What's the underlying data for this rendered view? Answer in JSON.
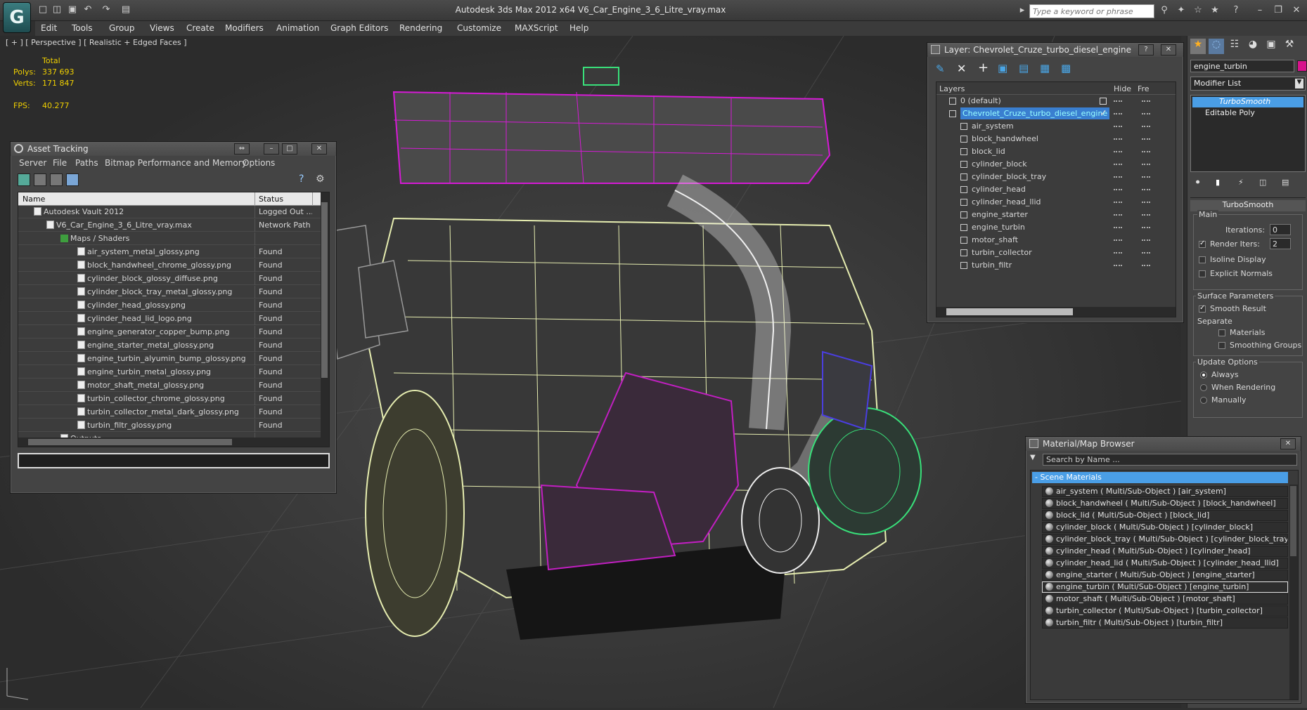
{
  "app": {
    "logo": "G",
    "title": "Autodesk 3ds Max  2012 x64     V6_Car_Engine_3_6_Litre_vray.max",
    "search_placeholder": "Type a keyword or phrase"
  },
  "menu": [
    "Edit",
    "Tools",
    "Group",
    "Views",
    "Create",
    "Modifiers",
    "Animation",
    "Graph Editors",
    "Rendering",
    "Customize",
    "MAXScript",
    "Help"
  ],
  "viewport": {
    "label": "[ + ] [ Perspective ] [ Realistic + Edged Faces ]",
    "stats": {
      "total_label": "Total",
      "polys_label": "Polys:",
      "polys": "337 693",
      "verts_label": "Verts:",
      "verts": "171 847",
      "fps_label": "FPS:",
      "fps": "40.277"
    }
  },
  "asset_tracking": {
    "title": "Asset Tracking",
    "menu": [
      "Server",
      "File",
      "Paths",
      "Bitmap Performance and Memory",
      "Options"
    ],
    "col_name": "Name",
    "col_status": "Status",
    "rows": [
      {
        "name": "Autodesk Vault 2012",
        "status": "Logged Out ..."
      },
      {
        "name": "V6_Car_Engine_3_6_Litre_vray.max",
        "status": "Network Path"
      },
      {
        "name": "Maps / Shaders",
        "status": ""
      },
      {
        "name": "air_system_metal_glossy.png",
        "status": "Found"
      },
      {
        "name": "block_handwheel_chrome_glossy.png",
        "status": "Found"
      },
      {
        "name": "cylinder_block_glossy_diffuse.png",
        "status": "Found"
      },
      {
        "name": "cylinder_block_tray_metal_glossy.png",
        "status": "Found"
      },
      {
        "name": "cylinder_head_glossy.png",
        "status": "Found"
      },
      {
        "name": "cylinder_head_lid_logo.png",
        "status": "Found"
      },
      {
        "name": "engine_generator_copper_bump.png",
        "status": "Found"
      },
      {
        "name": "engine_starter_metal_glossy.png",
        "status": "Found"
      },
      {
        "name": "engine_turbin_alyumin_bump_glossy.png",
        "status": "Found"
      },
      {
        "name": "engine_turbin_metal_glossy.png",
        "status": "Found"
      },
      {
        "name": "motor_shaft_metal_glossy.png",
        "status": "Found"
      },
      {
        "name": "turbin_collector_chrome_glossy.png",
        "status": "Found"
      },
      {
        "name": "turbin_collector_metal_dark_glossy.png",
        "status": "Found"
      },
      {
        "name": "turbin_filtr_glossy.png",
        "status": "Found"
      },
      {
        "name": "Outputs",
        "status": ""
      }
    ]
  },
  "layer": {
    "title": "Layer: Chevrolet_Cruze_turbo_diesel_engine",
    "col_layers": "Layers",
    "col_hide": "Hide",
    "col_freeze": "Fre",
    "rows": [
      "0 (default)",
      "Chevrolet_Cruze_turbo_diesel_engine",
      "air_system",
      "block_handwheel",
      "block_lid",
      "cylinder_block",
      "cylinder_block_tray",
      "cylinder_head",
      "cylinder_head_llid",
      "engine_starter",
      "engine_turbin",
      "motor_shaft",
      "turbin_collector",
      "turbin_filtr"
    ]
  },
  "command_panel": {
    "object_name": "engine_turbin",
    "object_color": "#d8128c",
    "modifier_list": "Modifier List",
    "stack": [
      "TurboSmooth",
      "Editable Poly"
    ],
    "rollout_title": "TurboSmooth",
    "main_label": "Main",
    "iterations_label": "Iterations:",
    "iterations": "0",
    "render_iters_label": "Render Iters:",
    "render_iters": "2",
    "isoline": "Isoline Display",
    "explicit": "Explicit Normals",
    "surface_label": "Surface Parameters",
    "smooth_result": "Smooth Result",
    "separate_label": "Separate",
    "materials": "Materials",
    "smoothing_groups": "Smoothing Groups",
    "update_label": "Update Options",
    "always": "Always",
    "when_rendering": "When Rendering",
    "manually": "Manually"
  },
  "material_browser": {
    "title": "Material/Map Browser",
    "search_placeholder": "Search by Name ...",
    "group": "- Scene Materials",
    "items": [
      "air_system  ( Multi/Sub-Object ) [air_system]",
      "block_handwheel  ( Multi/Sub-Object ) [block_handwheel]",
      "block_lid  ( Multi/Sub-Object ) [block_lid]",
      "cylinder_block  ( Multi/Sub-Object ) [cylinder_block]",
      "cylinder_block_tray  ( Multi/Sub-Object ) [cylinder_block_tray]",
      "cylinder_head  ( Multi/Sub-Object ) [cylinder_head]",
      "cylinder_head_lid  ( Multi/Sub-Object ) [cylinder_head_llid]",
      "engine_starter  ( Multi/Sub-Object ) [engine_starter]",
      "engine_turbin  ( Multi/Sub-Object ) [engine_turbin]",
      "motor_shaft  ( Multi/Sub-Object ) [motor_shaft]",
      "turbin_collector  ( Multi/Sub-Object ) [turbin_collector]",
      "turbin_filtr  ( Multi/Sub-Object ) [turbin_filtr]"
    ]
  }
}
